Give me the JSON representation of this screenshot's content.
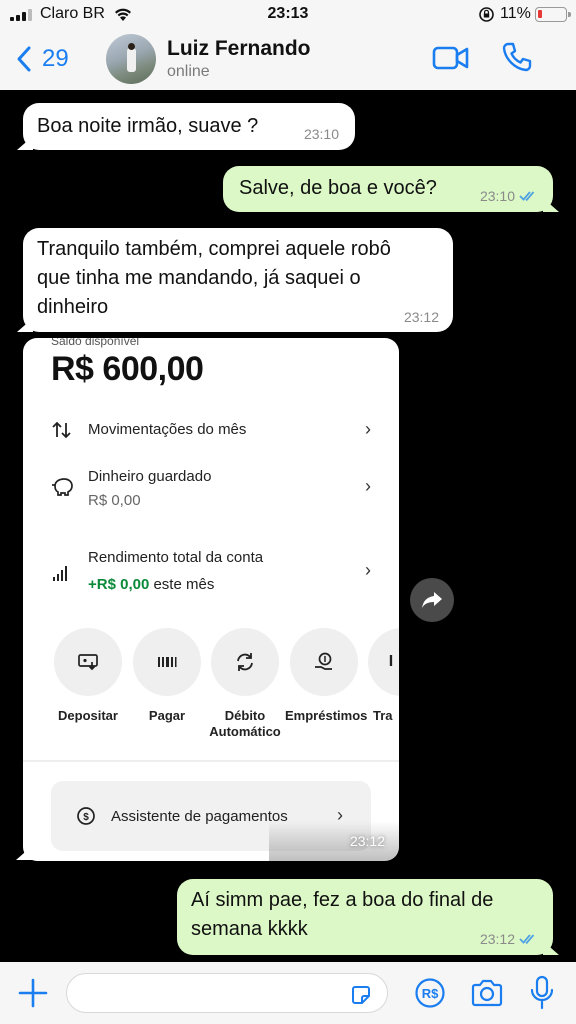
{
  "status_bar": {
    "carrier": "Claro BR",
    "time": "23:13",
    "battery": "11%"
  },
  "header": {
    "back_count": "29",
    "contact_name": "Luiz Fernando",
    "contact_status": "online"
  },
  "messages": [
    {
      "direction": "in",
      "text": "Boa noite irmão, suave ?",
      "time": "23:10"
    },
    {
      "direction": "out",
      "text": "Salve, de boa e você?",
      "time": "23:10",
      "read": true
    },
    {
      "direction": "in",
      "lines": [
        "Tranquilo também, comprei aquele robô",
        "que tinha me mandando, já saquei o",
        "dinheiro"
      ],
      "time": "23:12"
    },
    {
      "direction": "out",
      "lines": [
        "Aí simm pae, fez a boa do final de",
        "semana kkkk"
      ],
      "time": "23:12",
      "read": true
    }
  ],
  "image_message": {
    "time": "23:12",
    "screenshot": {
      "cut_label": "Saldo disponível",
      "balance": "R$ 600,00",
      "rows": [
        {
          "label": "Movimentações do mês"
        },
        {
          "label": "Dinheiro guardado",
          "sub": "R$ 0,00"
        },
        {
          "label": "Rendimento total da conta",
          "sub_value": "+R$ 0,00",
          "sub_suffix": " este mês"
        }
      ],
      "actions": [
        "Depositar",
        "Pagar",
        "Débito",
        "Empréstimos",
        "Tra"
      ],
      "actions_second_line": {
        "debit": "Automático"
      },
      "assistant": "Assistente de pagamentos"
    }
  },
  "composer": {
    "placeholder": ""
  },
  "colors": {
    "accent": "#1a7ef0",
    "outgoing_bubble": "#dcf8c6",
    "incoming_bubble": "#ffffff",
    "read_ticks": "#4fa3e3",
    "positive": "#0b8a3a"
  }
}
